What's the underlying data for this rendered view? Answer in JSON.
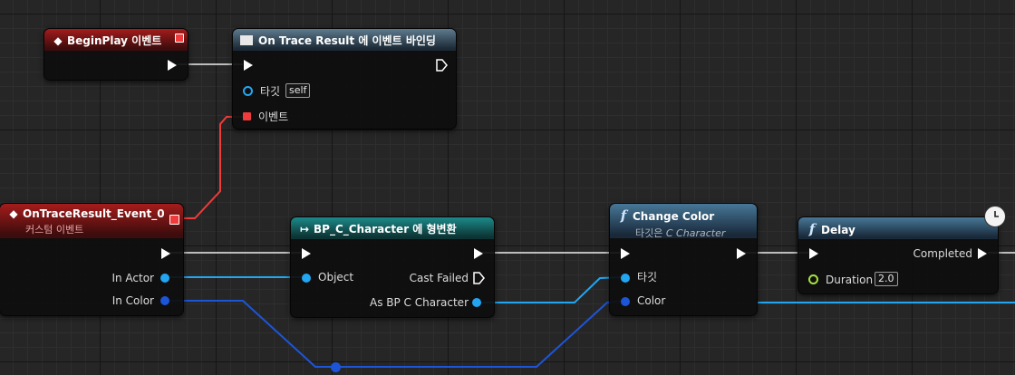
{
  "colors": {
    "exec_wire": "#bdbdbd",
    "event_wire": "#ef3b3b",
    "object_wire": "#22a6f2",
    "color_wire": "#1d55d8",
    "float_pin": "#a7e23f"
  },
  "nodes": {
    "begin_play": {
      "title": "BeginPlay 이벤트",
      "icon": "event-diamond-icon"
    },
    "bind_event": {
      "title": "On Trace Result 에 이벤트 바인딩",
      "icon": "bind-event-icon",
      "pins": {
        "target_label": "타깃",
        "target_value": "self",
        "event_label": "이벤트"
      }
    },
    "custom_event": {
      "title": "OnTraceResult_Event_0",
      "subtitle": "커스텀 이벤트",
      "icon": "event-diamond-icon",
      "pins": {
        "in_actor": "In Actor",
        "in_color": "In Color"
      }
    },
    "cast": {
      "title": "BP_C_Character 에 형변환",
      "icon": "cast-arrow-icon",
      "pins": {
        "object": "Object",
        "cast_failed": "Cast Failed",
        "as_character": "As BP C Character"
      }
    },
    "change_color": {
      "title": "Change Color",
      "subtitle_prefix": "타깃은",
      "subtitle_class": "C Character",
      "icon": "function-icon",
      "pins": {
        "target": "타깃",
        "color": "Color"
      }
    },
    "delay": {
      "title": "Delay",
      "icon": "function-icon",
      "latent_icon": "clock-icon",
      "pins": {
        "completed": "Completed",
        "duration_label": "Duration",
        "duration_value": "2.0"
      }
    }
  }
}
